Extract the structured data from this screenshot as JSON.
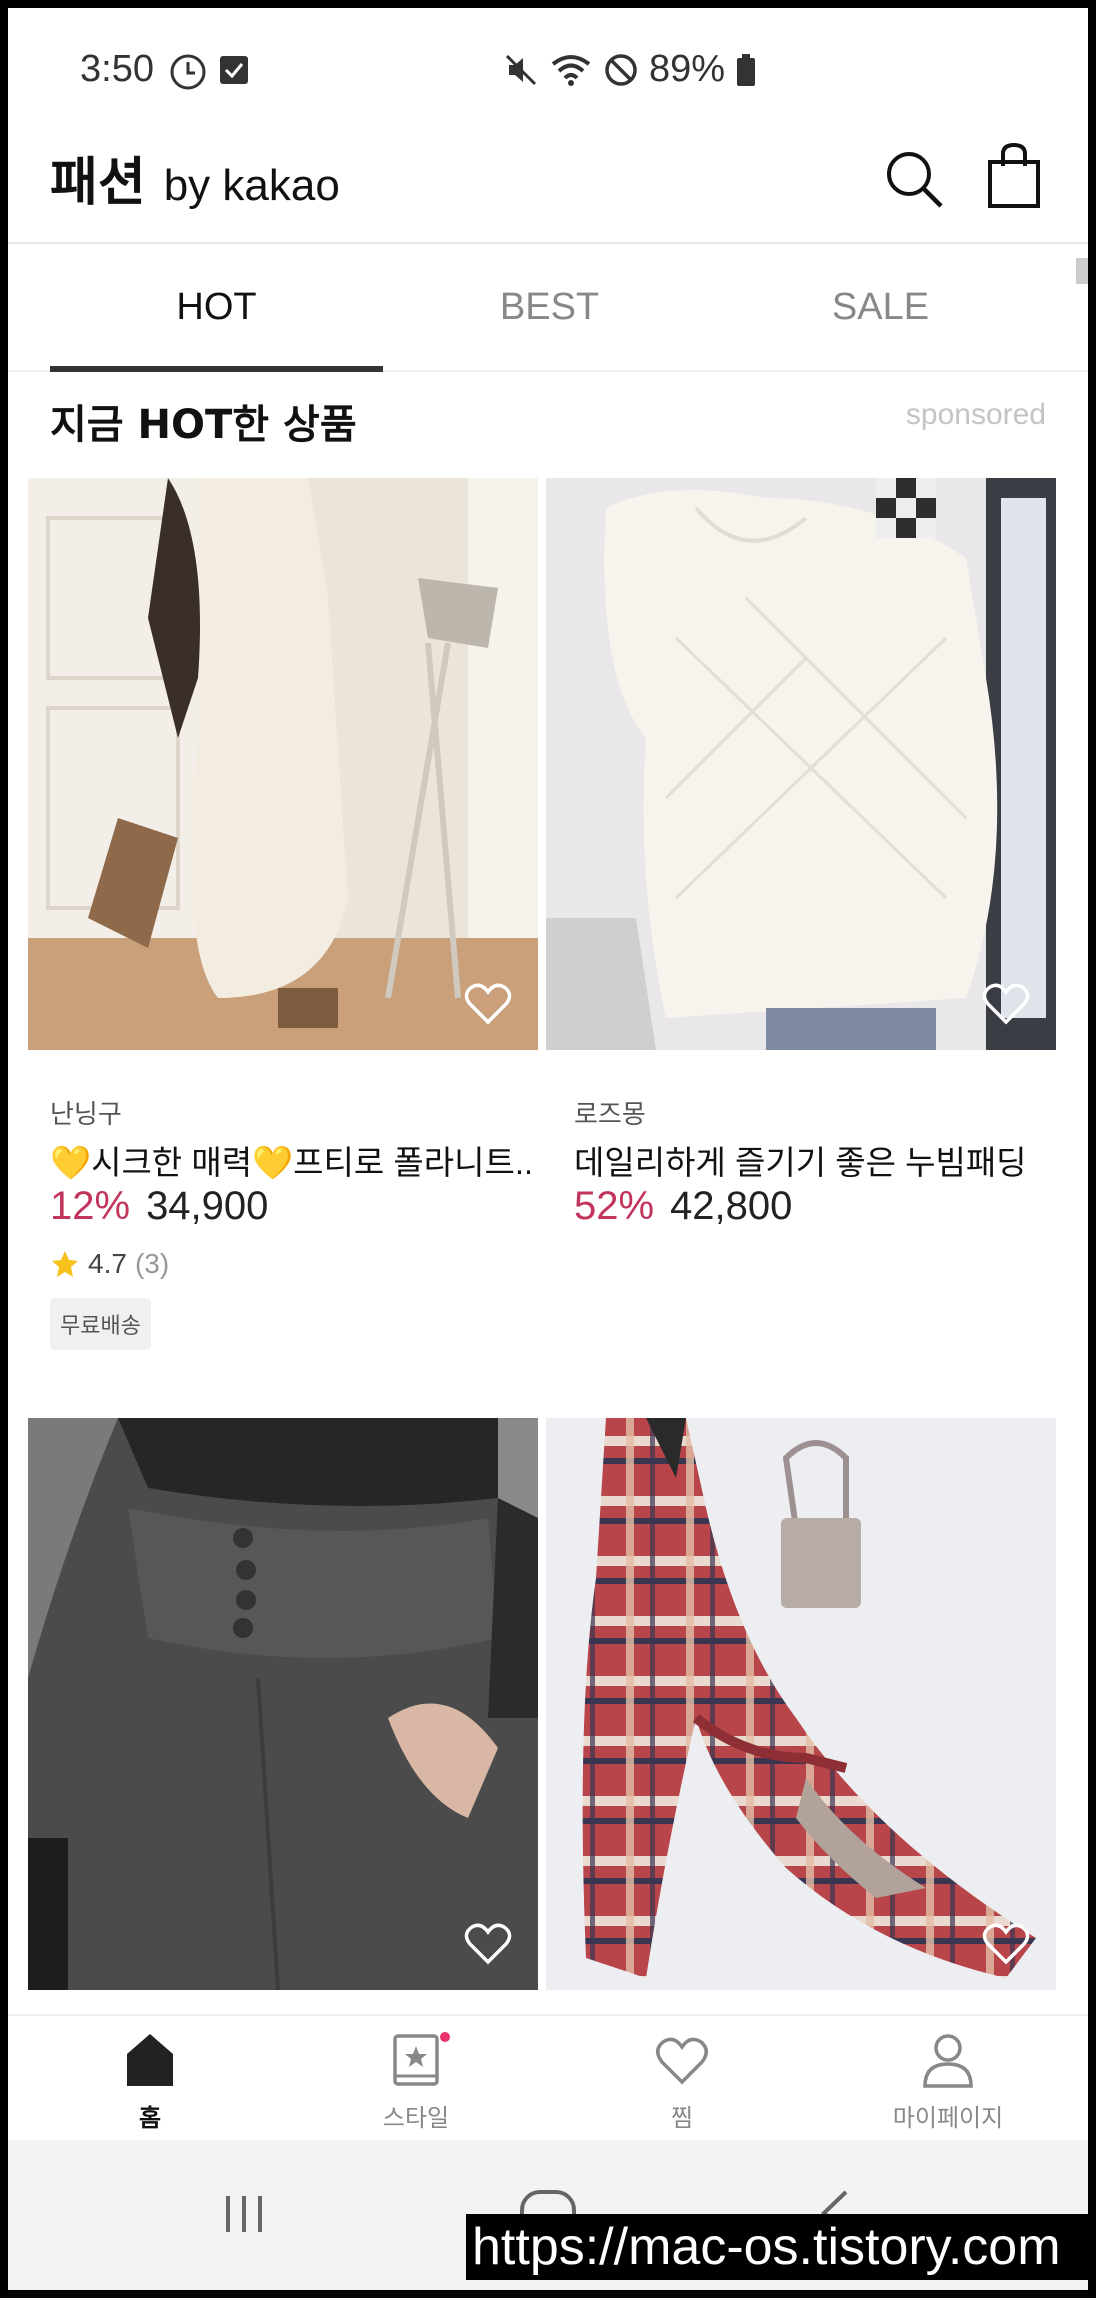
{
  "status_bar": {
    "time": "3:50",
    "battery": "89%"
  },
  "header": {
    "logo_main": "패션",
    "logo_sub": "by kakao"
  },
  "tabs": [
    {
      "label": "HOT",
      "active": true
    },
    {
      "label": "BEST",
      "active": false
    },
    {
      "label": "SALE",
      "active": false
    }
  ],
  "section": {
    "title": "지금 HOT한 상품",
    "sponsored": "sponsored"
  },
  "products": [
    {
      "brand": "난닝구",
      "name": "💛시크한 매력💛프티로 폴라니트...",
      "discount": "12%",
      "price": "34,900",
      "rating": "4.7",
      "rating_count": "(3)",
      "tag": "무료배송"
    },
    {
      "brand": "로즈몽",
      "name": "데일리하게 즐기기 좋은 누빔패딩",
      "discount": "52%",
      "price": "42,800"
    },
    {},
    {}
  ],
  "bottom_nav": [
    {
      "label": "홈",
      "icon": "home-icon",
      "active": true
    },
    {
      "label": "스타일",
      "icon": "style-book-icon",
      "active": false
    },
    {
      "label": "찜",
      "icon": "heart-icon",
      "active": false
    },
    {
      "label": "마이페이지",
      "icon": "person-icon",
      "active": false
    }
  ],
  "watermark": "https://mac-os.tistory.com",
  "colors": {
    "discount": "#c2345b",
    "accent_dot": "#e8336b"
  }
}
